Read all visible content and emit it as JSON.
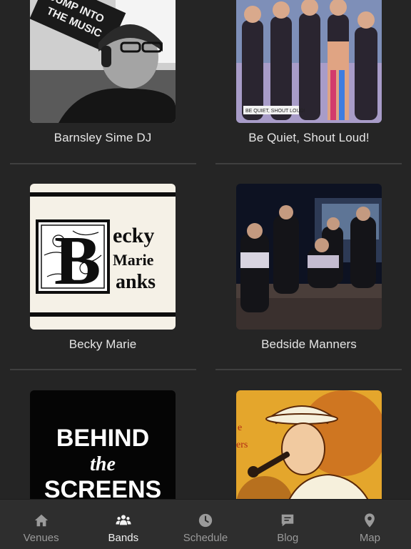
{
  "bands": [
    {
      "name": "Barnsley Sime DJ",
      "image_text": [
        "JUMP INTO",
        "THE MUSIC"
      ]
    },
    {
      "name": "Be Quiet, Shout Loud!",
      "image_text": [
        "BE QUIET, SHOUT LOUD!"
      ]
    },
    {
      "name": "Becky Marie",
      "image_text": [
        "B",
        "ecky",
        "Marie",
        "anks"
      ]
    },
    {
      "name": "Bedside Manners",
      "image_text": []
    },
    {
      "name": "",
      "image_text": [
        "BEHIND",
        "the",
        "SCREENS"
      ]
    },
    {
      "name": "",
      "image_text": [
        "e",
        "ers"
      ]
    }
  ],
  "tabs": [
    {
      "label": "Venues",
      "icon": "home-icon",
      "active": false
    },
    {
      "label": "Bands",
      "icon": "users-icon",
      "active": true
    },
    {
      "label": "Schedule",
      "icon": "clock-icon",
      "active": false
    },
    {
      "label": "Blog",
      "icon": "message-icon",
      "active": false
    },
    {
      "label": "Map",
      "icon": "map-pin-icon",
      "active": false
    }
  ],
  "colors": {
    "background": "#252525",
    "tabbar": "#2e2e2e",
    "active_tab": "#f2f2f2",
    "inactive_tab": "#9a9a9a"
  }
}
